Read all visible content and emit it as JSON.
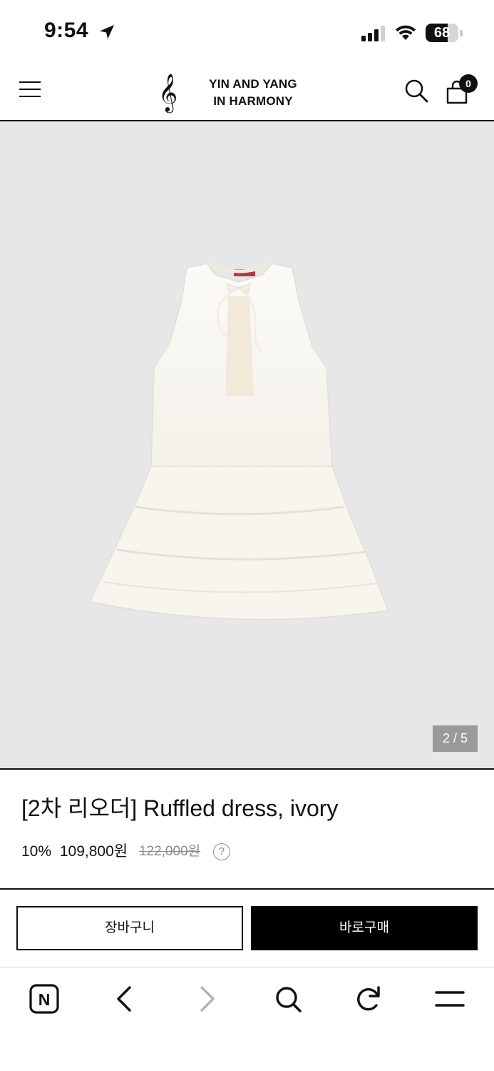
{
  "status_bar": {
    "time": "9:54",
    "battery_level": "68",
    "battery_fraction": 0.68,
    "icons": [
      "location-arrow-icon",
      "cellular-signal-icon",
      "wifi-icon",
      "battery-icon"
    ]
  },
  "header": {
    "logo_line1": "YIN AND YANG",
    "logo_line2": "IN HARMONY",
    "logo_symbol": "𝄞",
    "cart_count": "0",
    "icons": [
      "menu-icon",
      "search-icon",
      "shopping-bag-icon"
    ]
  },
  "gallery": {
    "counter": "2 / 5",
    "background": "#e7e7e7"
  },
  "product": {
    "title": "[2차 리오더] Ruffled dress, ivory",
    "discount": "10%",
    "sale_price": "109,800원",
    "original_price": "122,000원",
    "help_symbol": "?"
  },
  "actions": {
    "cart_label": "장바구니",
    "buy_label": "바로구매"
  },
  "browser_toolbar": {
    "home_letter": "N",
    "icons": [
      "naver-home-icon",
      "back-icon",
      "forward-icon",
      "search-icon",
      "reload-icon",
      "menu-icon"
    ]
  },
  "colors": {
    "accent": "#000000",
    "muted": "#8a8a8a",
    "counter_bg": "#9a9a9a"
  }
}
